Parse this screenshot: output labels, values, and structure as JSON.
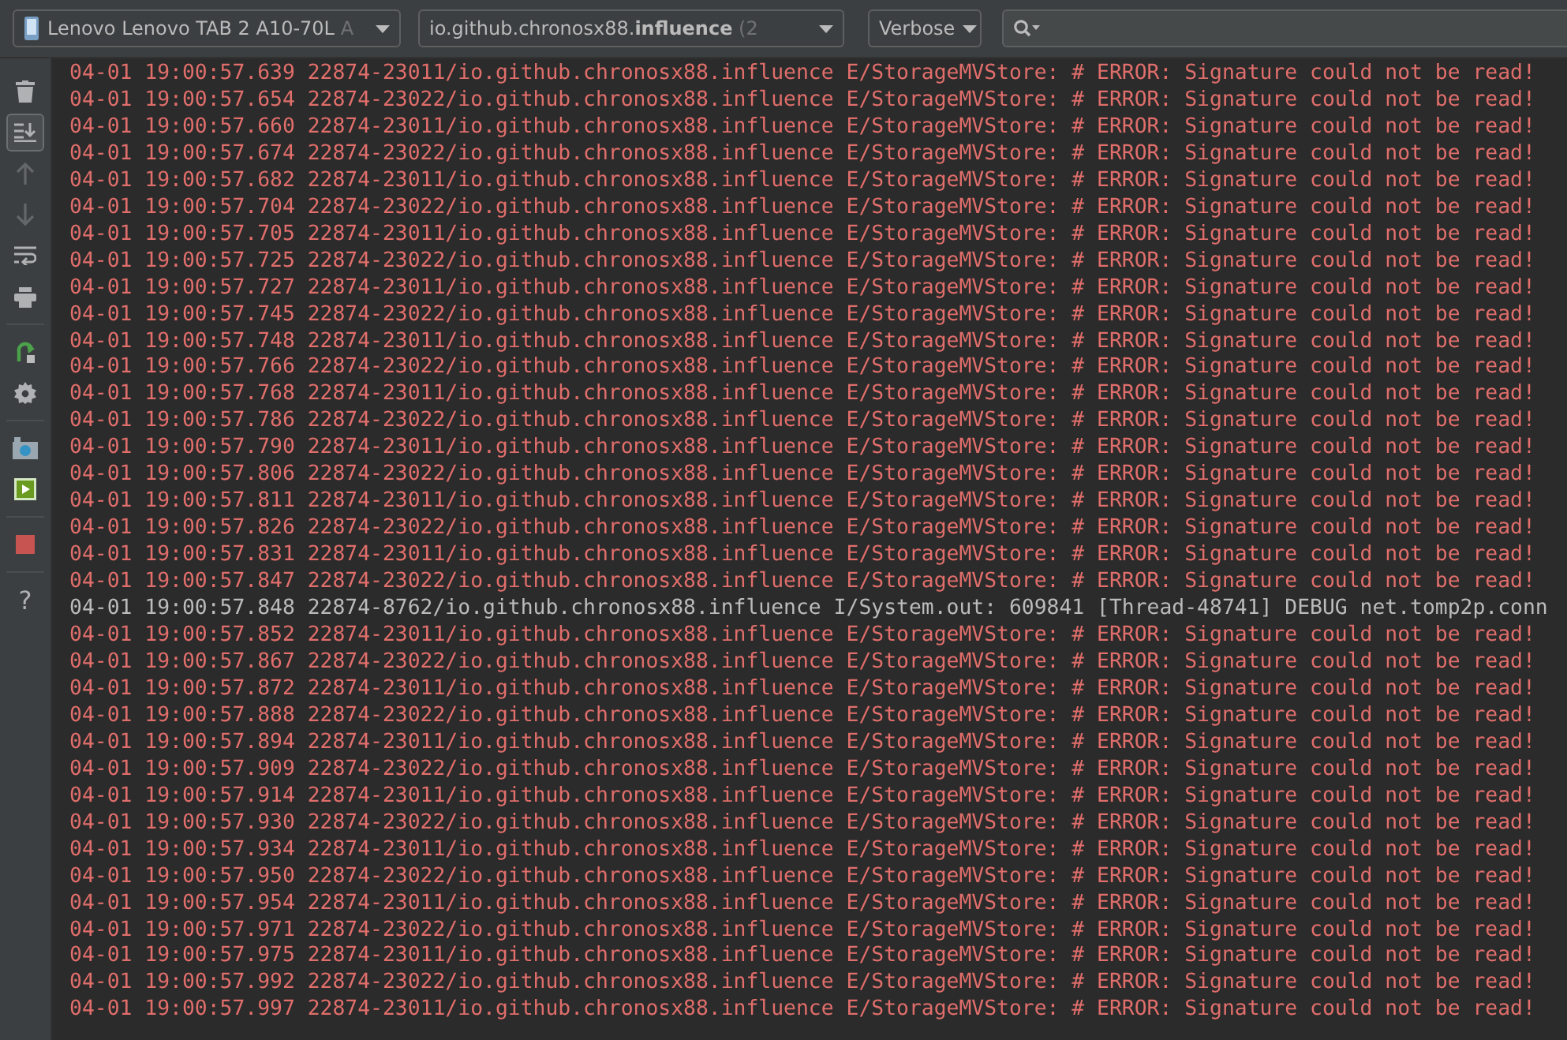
{
  "toolbar": {
    "device": {
      "label": "Lenovo Lenovo TAB 2 A10-70L",
      "suffix": "A"
    },
    "process": {
      "label": "io.github.chronosx88.**influence**",
      "suffix": "(2"
    },
    "log_level": {
      "label": "Verbose"
    }
  },
  "tool_groups": [
    [
      {
        "kind": "trash",
        "selected": false,
        "disabled": false
      },
      {
        "kind": "scroll-end",
        "selected": true,
        "disabled": false
      },
      {
        "kind": "up",
        "selected": false,
        "disabled": true
      },
      {
        "kind": "down",
        "selected": false,
        "disabled": true
      },
      {
        "kind": "wrap",
        "selected": false,
        "disabled": false
      },
      {
        "kind": "print",
        "selected": false,
        "disabled": false
      }
    ],
    [
      {
        "kind": "restart",
        "selected": false,
        "disabled": false
      },
      {
        "kind": "settings",
        "selected": false,
        "disabled": false
      }
    ],
    [
      {
        "kind": "camera",
        "selected": false,
        "disabled": false
      },
      {
        "kind": "record",
        "selected": false,
        "disabled": false
      }
    ],
    [
      {
        "kind": "stop",
        "selected": false,
        "disabled": false
      }
    ],
    [
      {
        "kind": "help",
        "selected": false,
        "disabled": false,
        "label": "?"
      }
    ]
  ],
  "log": [
    {
      "kind": "error",
      "text": "04-01 19:00:57.639 22874-23011/io.github.chronosx88.influence E/StorageMVStore: # ERROR: Signature could not be read!"
    },
    {
      "kind": "error",
      "text": "04-01 19:00:57.654 22874-23022/io.github.chronosx88.influence E/StorageMVStore: # ERROR: Signature could not be read!"
    },
    {
      "kind": "error",
      "text": "04-01 19:00:57.660 22874-23011/io.github.chronosx88.influence E/StorageMVStore: # ERROR: Signature could not be read!"
    },
    {
      "kind": "error",
      "text": "04-01 19:00:57.674 22874-23022/io.github.chronosx88.influence E/StorageMVStore: # ERROR: Signature could not be read!"
    },
    {
      "kind": "error",
      "text": "04-01 19:00:57.682 22874-23011/io.github.chronosx88.influence E/StorageMVStore: # ERROR: Signature could not be read!"
    },
    {
      "kind": "error",
      "text": "04-01 19:00:57.704 22874-23022/io.github.chronosx88.influence E/StorageMVStore: # ERROR: Signature could not be read!"
    },
    {
      "kind": "error",
      "text": "04-01 19:00:57.705 22874-23011/io.github.chronosx88.influence E/StorageMVStore: # ERROR: Signature could not be read!"
    },
    {
      "kind": "error",
      "text": "04-01 19:00:57.725 22874-23022/io.github.chronosx88.influence E/StorageMVStore: # ERROR: Signature could not be read!"
    },
    {
      "kind": "error",
      "text": "04-01 19:00:57.727 22874-23011/io.github.chronosx88.influence E/StorageMVStore: # ERROR: Signature could not be read!"
    },
    {
      "kind": "error",
      "text": "04-01 19:00:57.745 22874-23022/io.github.chronosx88.influence E/StorageMVStore: # ERROR: Signature could not be read!"
    },
    {
      "kind": "error",
      "text": "04-01 19:00:57.748 22874-23011/io.github.chronosx88.influence E/StorageMVStore: # ERROR: Signature could not be read!"
    },
    {
      "kind": "error",
      "text": "04-01 19:00:57.766 22874-23022/io.github.chronosx88.influence E/StorageMVStore: # ERROR: Signature could not be read!"
    },
    {
      "kind": "error",
      "text": "04-01 19:00:57.768 22874-23011/io.github.chronosx88.influence E/StorageMVStore: # ERROR: Signature could not be read!"
    },
    {
      "kind": "error",
      "text": "04-01 19:00:57.786 22874-23022/io.github.chronosx88.influence E/StorageMVStore: # ERROR: Signature could not be read!"
    },
    {
      "kind": "error",
      "text": "04-01 19:00:57.790 22874-23011/io.github.chronosx88.influence E/StorageMVStore: # ERROR: Signature could not be read!"
    },
    {
      "kind": "error",
      "text": "04-01 19:00:57.806 22874-23022/io.github.chronosx88.influence E/StorageMVStore: # ERROR: Signature could not be read!"
    },
    {
      "kind": "error",
      "text": "04-01 19:00:57.811 22874-23011/io.github.chronosx88.influence E/StorageMVStore: # ERROR: Signature could not be read!"
    },
    {
      "kind": "error",
      "text": "04-01 19:00:57.826 22874-23022/io.github.chronosx88.influence E/StorageMVStore: # ERROR: Signature could not be read!"
    },
    {
      "kind": "error",
      "text": "04-01 19:00:57.831 22874-23011/io.github.chronosx88.influence E/StorageMVStore: # ERROR: Signature could not be read!"
    },
    {
      "kind": "error",
      "text": "04-01 19:00:57.847 22874-23022/io.github.chronosx88.influence E/StorageMVStore: # ERROR: Signature could not be read!"
    },
    {
      "kind": "info",
      "text": "04-01 19:00:57.848 22874-8762/io.github.chronosx88.influence I/System.out: 609841 [Thread-48741] DEBUG net.tomp2p.conn"
    },
    {
      "kind": "error",
      "text": "04-01 19:00:57.852 22874-23011/io.github.chronosx88.influence E/StorageMVStore: # ERROR: Signature could not be read!"
    },
    {
      "kind": "error",
      "text": "04-01 19:00:57.867 22874-23022/io.github.chronosx88.influence E/StorageMVStore: # ERROR: Signature could not be read!"
    },
    {
      "kind": "error",
      "text": "04-01 19:00:57.872 22874-23011/io.github.chronosx88.influence E/StorageMVStore: # ERROR: Signature could not be read!"
    },
    {
      "kind": "error",
      "text": "04-01 19:00:57.888 22874-23022/io.github.chronosx88.influence E/StorageMVStore: # ERROR: Signature could not be read!"
    },
    {
      "kind": "error",
      "text": "04-01 19:00:57.894 22874-23011/io.github.chronosx88.influence E/StorageMVStore: # ERROR: Signature could not be read!"
    },
    {
      "kind": "error",
      "text": "04-01 19:00:57.909 22874-23022/io.github.chronosx88.influence E/StorageMVStore: # ERROR: Signature could not be read!"
    },
    {
      "kind": "error",
      "text": "04-01 19:00:57.914 22874-23011/io.github.chronosx88.influence E/StorageMVStore: # ERROR: Signature could not be read!"
    },
    {
      "kind": "error",
      "text": "04-01 19:00:57.930 22874-23022/io.github.chronosx88.influence E/StorageMVStore: # ERROR: Signature could not be read!"
    },
    {
      "kind": "error",
      "text": "04-01 19:00:57.934 22874-23011/io.github.chronosx88.influence E/StorageMVStore: # ERROR: Signature could not be read!"
    },
    {
      "kind": "error",
      "text": "04-01 19:00:57.950 22874-23022/io.github.chronosx88.influence E/StorageMVStore: # ERROR: Signature could not be read!"
    },
    {
      "kind": "error",
      "text": "04-01 19:00:57.954 22874-23011/io.github.chronosx88.influence E/StorageMVStore: # ERROR: Signature could not be read!"
    },
    {
      "kind": "error",
      "text": "04-01 19:00:57.971 22874-23022/io.github.chronosx88.influence E/StorageMVStore: # ERROR: Signature could not be read!"
    },
    {
      "kind": "error",
      "text": "04-01 19:00:57.975 22874-23011/io.github.chronosx88.influence E/StorageMVStore: # ERROR: Signature could not be read!"
    },
    {
      "kind": "error",
      "text": "04-01 19:00:57.992 22874-23022/io.github.chronosx88.influence E/StorageMVStore: # ERROR: Signature could not be read!"
    },
    {
      "kind": "error",
      "text": "04-01 19:00:57.997 22874-23011/io.github.chronosx88.influence E/StorageMVStore: # ERROR: Signature could not be read!"
    }
  ]
}
